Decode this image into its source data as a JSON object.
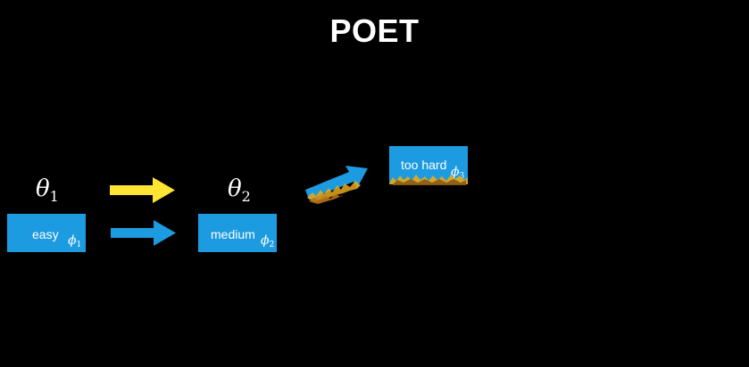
{
  "title": "POET",
  "thetas": [
    {
      "symbol": "θ",
      "sub": "1"
    },
    {
      "symbol": "θ",
      "sub": "2"
    }
  ],
  "environments": [
    {
      "label": "easy",
      "phi_symbol": "ϕ",
      "phi_sub": "1"
    },
    {
      "label": "medium",
      "phi_symbol": "ϕ",
      "phi_sub": "2"
    },
    {
      "label": "too hard",
      "phi_symbol": "ϕ",
      "phi_sub": "3"
    }
  ],
  "colors": {
    "background": "#000000",
    "box": "#1d9be0",
    "agent_arrow": "#ffe433",
    "env_arrow": "#1d9be0",
    "fire": "#e8a81c",
    "text": "#ffffff"
  }
}
